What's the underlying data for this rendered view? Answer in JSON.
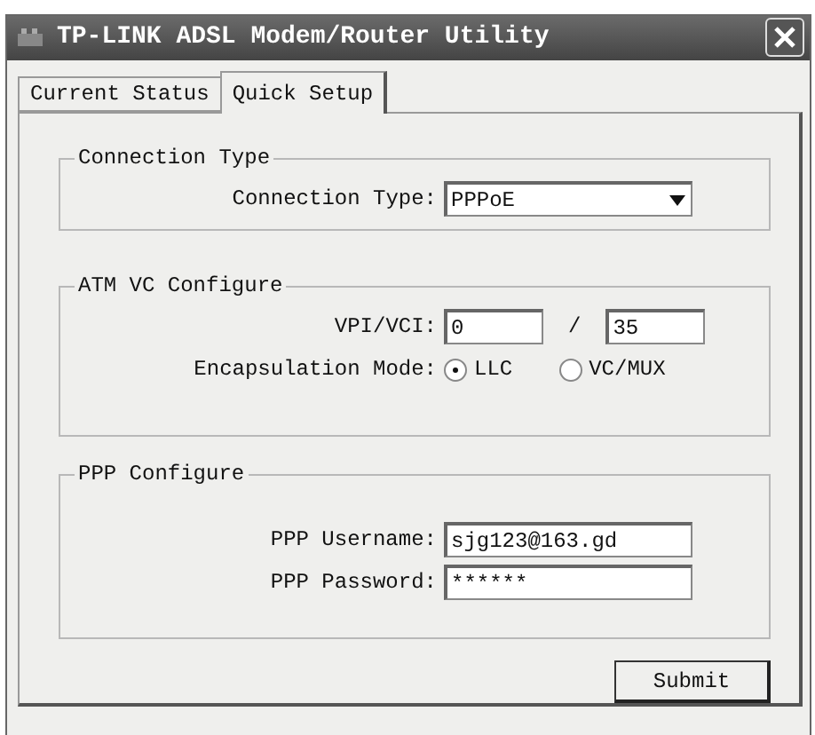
{
  "window": {
    "title": "TP-LINK ADSL Modem/Router Utility"
  },
  "tabs": [
    {
      "label": "Current Status",
      "selected": false
    },
    {
      "label": "Quick Setup",
      "selected": true
    }
  ],
  "connection_group": {
    "title": "Connection Type",
    "label": "Connection Type:",
    "value": "PPPoE"
  },
  "atm_group": {
    "title": "ATM VC Configure",
    "vpi_vci_label": "VPI/VCI:",
    "vpi": "0",
    "separator": "/",
    "vci": "35",
    "encapsulation_label": "Encapsulation Mode:",
    "modes": [
      {
        "label": "LLC",
        "selected": true
      },
      {
        "label": "VC/MUX",
        "selected": false
      }
    ]
  },
  "ppp_group": {
    "title": "PPP Configure",
    "username_label": "PPP Username:",
    "username": "sjg123@163.gd",
    "password_label": "PPP Password:",
    "password": "******"
  },
  "buttons": [
    "Submit"
  ]
}
